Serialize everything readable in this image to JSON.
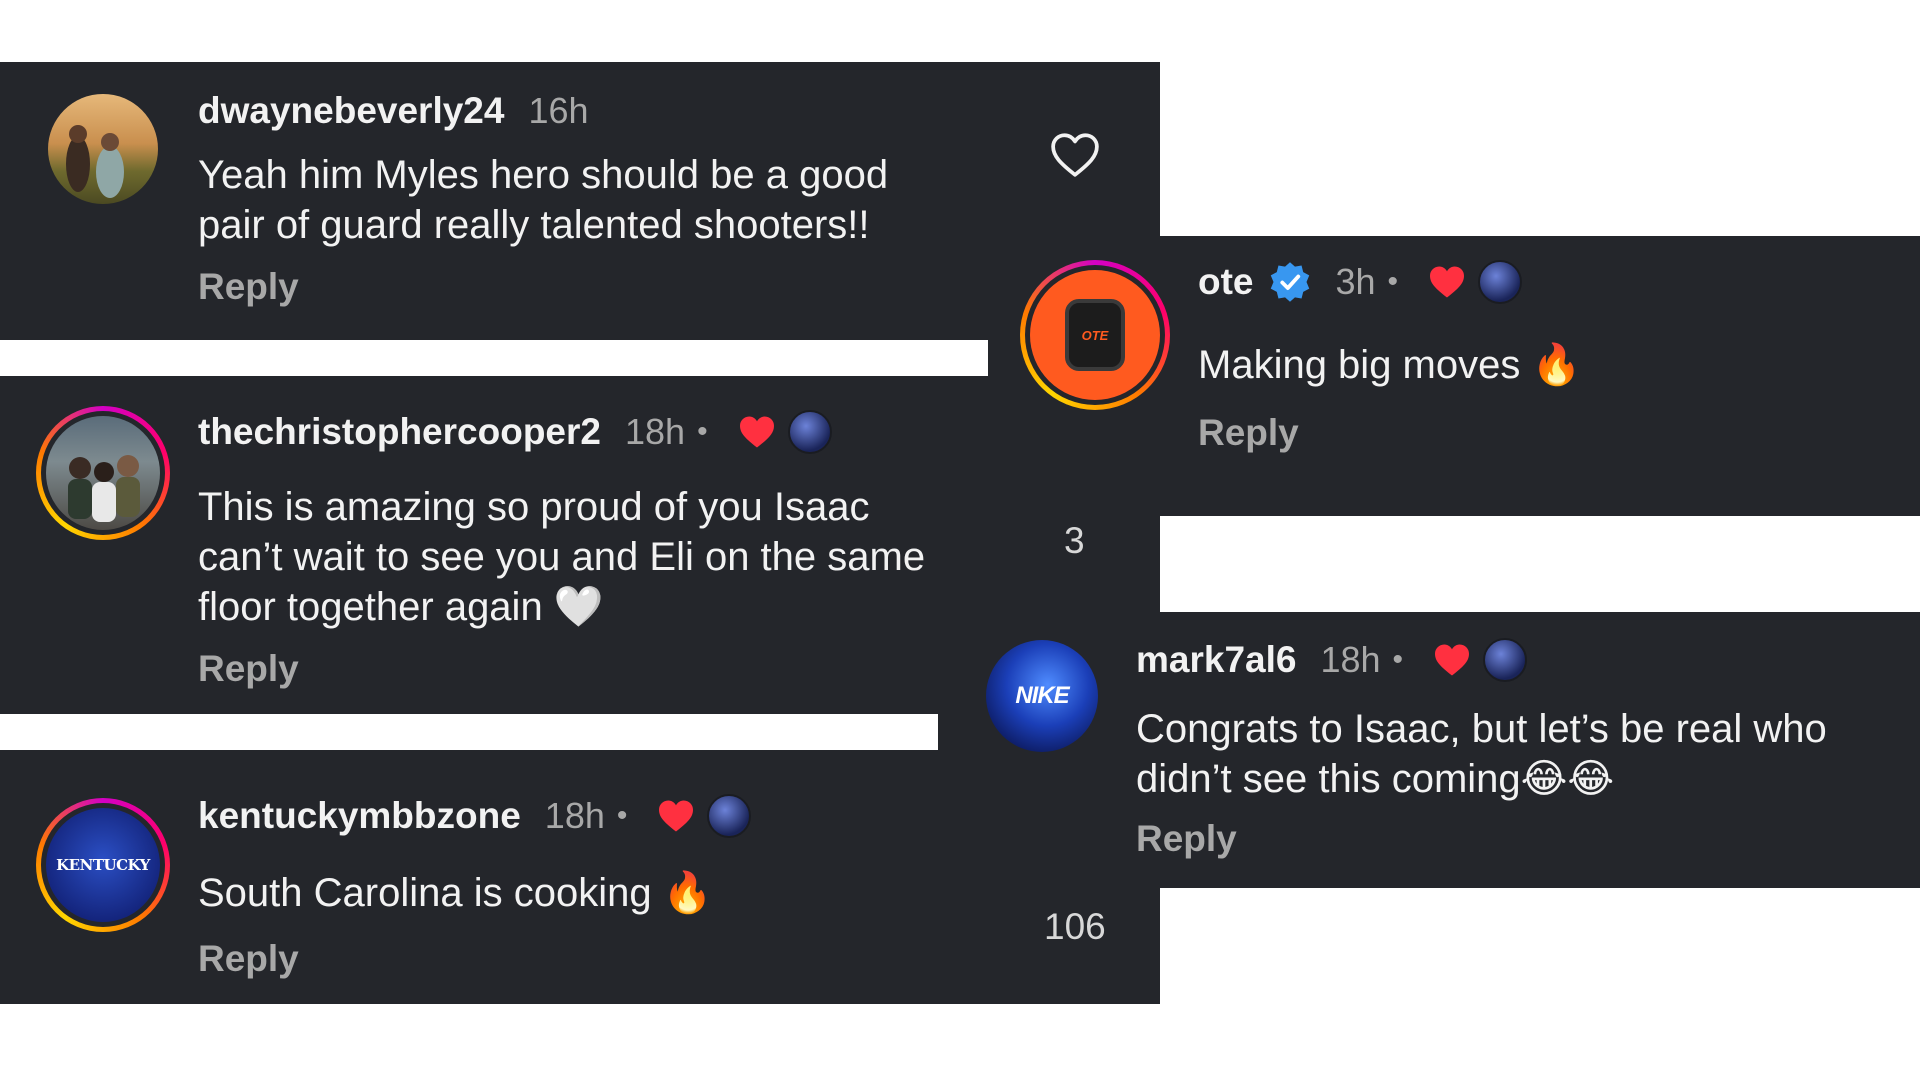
{
  "comments": [
    {
      "username": "dwaynebeverly24",
      "time": "16h",
      "text_lines": [
        "Yeah him Myles hero should be a good",
        "pair of guard really talented shooters!!"
      ],
      "reply": "Reply"
    },
    {
      "username": "thechristophercooper2",
      "time": "18h",
      "dot": "•",
      "text_lines": [
        "This is amazing so proud of you Isaac",
        "can’t wait to see you and Eli on the same",
        "floor together again 🤍"
      ],
      "reply": "Reply",
      "like_count": "3"
    },
    {
      "username": "kentuckymbbzone",
      "time": "18h",
      "dot": "•",
      "text_lines": [
        "South Carolina is cooking 🔥"
      ],
      "reply": "Reply",
      "like_count": "106",
      "avatar_text": "KENTUCKY"
    },
    {
      "username": "ote",
      "time": "3h",
      "dot": "•",
      "text_lines": [
        "Making big moves 🔥"
      ],
      "reply": "Reply",
      "verified": true,
      "avatar_text": "OTE"
    },
    {
      "username": "mark7al6",
      "time": "18h",
      "dot": "•",
      "text_lines": [
        "Congrats to Isaac, but let’s be real who",
        "didn’t see this coming😂😂"
      ],
      "reply": "Reply",
      "avatar_text": "NIKE"
    }
  ],
  "colors": {
    "card_bg": "#24262b",
    "heart_red": "#ff3040",
    "verified_blue": "#3897f0",
    "muted_text": "#a8a8a8"
  },
  "icons": [
    "heart-outline-icon",
    "heart-filled-icon",
    "verified-badge-icon"
  ]
}
